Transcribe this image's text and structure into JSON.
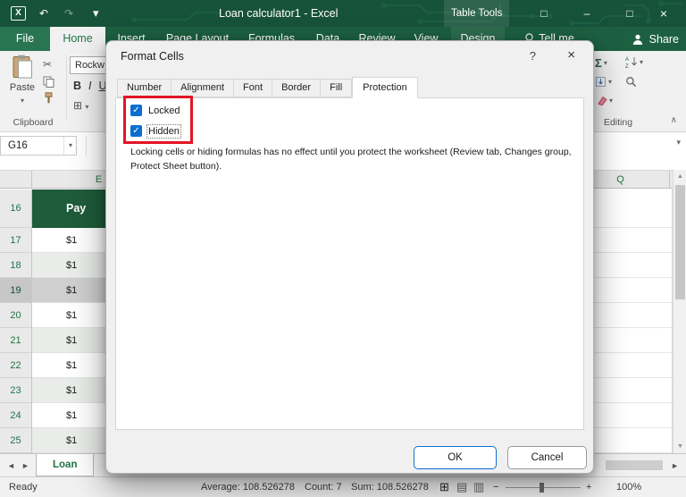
{
  "titlebar": {
    "app_letter": "X",
    "title": "Loan calculator1 - Excel",
    "context_tab": "Table Tools"
  },
  "icons": {
    "undo": "↶",
    "redo": "↷",
    "dropdown": "▾",
    "minimize": "–",
    "maximize": "□",
    "close": "×",
    "help": "?",
    "check": "✓",
    "sigma": "Σ",
    "scissors": "✂",
    "borders": "⊞",
    "nav_left": "◄",
    "nav_right": "►",
    "scroll_up": "▲",
    "scroll_down": "▼",
    "collapse_ribbon": "∧",
    "minus": "−",
    "plus": "+",
    "view_normal": "⊞",
    "view_layout": "▤",
    "view_break": "▥"
  },
  "ribbon": {
    "tabs": [
      {
        "label": "File"
      },
      {
        "label": "Home"
      },
      {
        "label": "Insert"
      },
      {
        "label": "Page Layout"
      },
      {
        "label": "Formulas"
      },
      {
        "label": "Data"
      },
      {
        "label": "Review"
      },
      {
        "label": "View"
      },
      {
        "label": "Design"
      },
      {
        "label": "Tell me"
      }
    ],
    "share": "Share",
    "paste": "Paste",
    "font_name": "Rockw",
    "bold": "B",
    "italic": "I",
    "underline": "U",
    "clipboard_group": "Clipboard",
    "editing_group": "Editing"
  },
  "formula_bar": {
    "name_box": "G16"
  },
  "grid": {
    "col_left": "E",
    "col_right": "Q",
    "header_row": {
      "num": "16",
      "value": "Pay"
    },
    "rows": [
      {
        "num": "17",
        "value": "$1"
      },
      {
        "num": "18",
        "value": "$1"
      },
      {
        "num": "19",
        "value": "$1"
      },
      {
        "num": "20",
        "value": "$1"
      },
      {
        "num": "21",
        "value": "$1"
      },
      {
        "num": "22",
        "value": "$1"
      },
      {
        "num": "23",
        "value": "$1"
      },
      {
        "num": "24",
        "value": "$1"
      },
      {
        "num": "25",
        "value": "$1"
      }
    ]
  },
  "sheet_tabs": {
    "active_tab": "Loan"
  },
  "status_bar": {
    "mode": "Ready",
    "average": "Average: 108.526278",
    "count": "Count: 7",
    "sum": "Sum: 108.526278",
    "zoom": "100%"
  },
  "dialog": {
    "title": "Format Cells",
    "tabs": [
      {
        "label": "Number"
      },
      {
        "label": "Alignment"
      },
      {
        "label": "Font"
      },
      {
        "label": "Border"
      },
      {
        "label": "Fill"
      },
      {
        "label": "Protection"
      }
    ],
    "locked": "Locked",
    "hidden": "Hidden",
    "description": "Locking cells or hiding formulas has no effect until you protect the worksheet (Review tab, Changes group, Protect Sheet button).",
    "ok": "OK",
    "cancel": "Cancel"
  },
  "colors": {
    "excel_green": "#217346",
    "titlebar_green": "#17533a",
    "accent_blue": "#0b6fd0",
    "highlight_red": "#e31426",
    "table_header_green": "#1f5c3b"
  }
}
